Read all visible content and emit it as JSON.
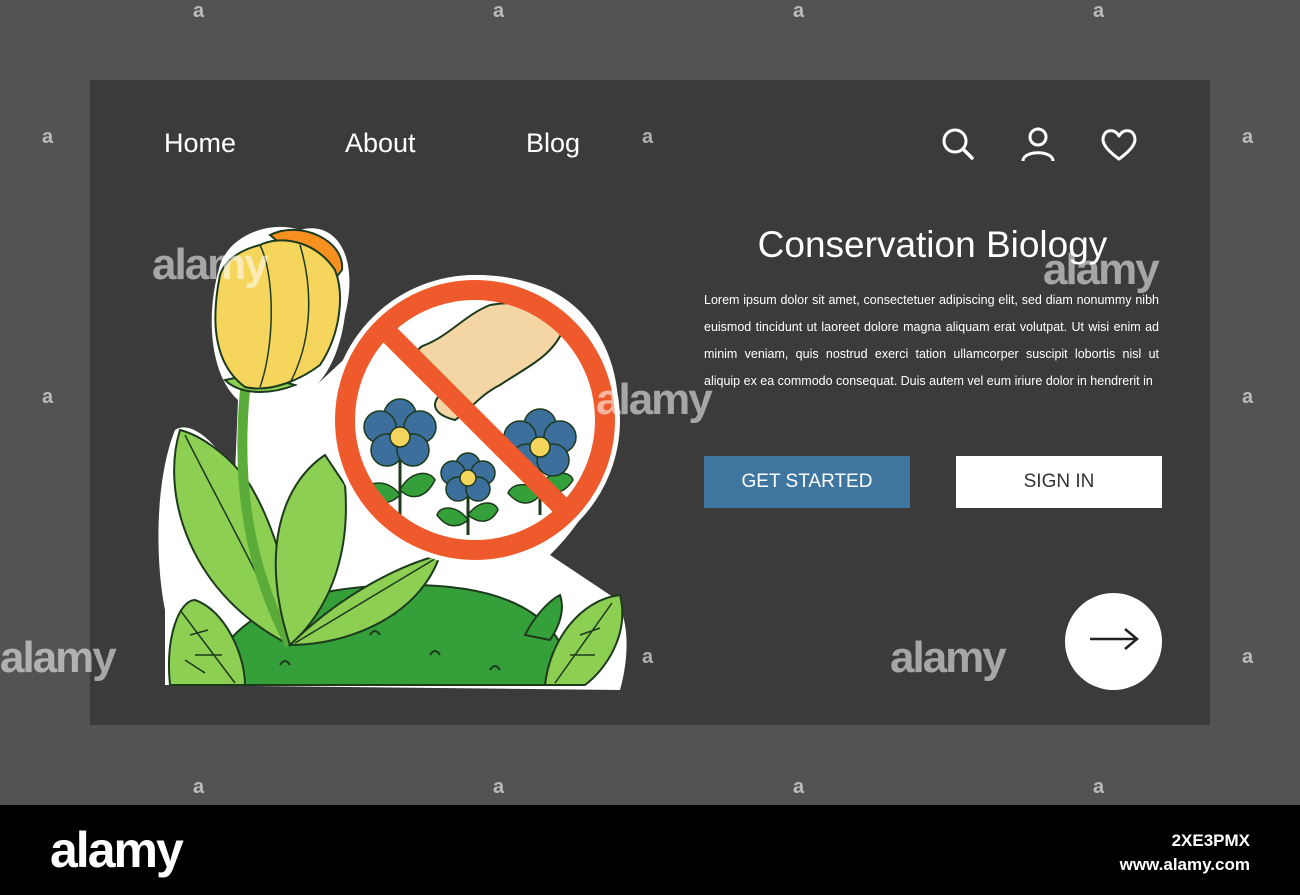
{
  "nav": {
    "items": [
      {
        "label": "Home"
      },
      {
        "label": "About"
      },
      {
        "label": "Blog"
      }
    ],
    "icons": [
      "search-icon",
      "user-icon",
      "heart-icon"
    ]
  },
  "hero": {
    "title": "Conservation Biology",
    "body": "Lorem ipsum dolor sit amet, consectetuer adipiscing elit, sed diam nonummy nibh euismod tincidunt ut laoreet dolore magna aliquam erat volutpat. Ut wisi enim ad minim veniam, quis nostrud exerci tation ullamcorper suscipit lobortis nisl ut aliquip ex ea commodo consequat. Duis autem vel eum iriure dolor in hendrerit in",
    "primary_button": "GET STARTED",
    "secondary_button": "SIGN IN",
    "next_icon": "arrow-right-icon"
  },
  "watermark": {
    "brand": "alamy",
    "mark": "a",
    "image_id": "2XE3PMX",
    "site": "www.alamy.com"
  },
  "colors": {
    "background": "#535353",
    "frame": "#3b3b3b",
    "primary": "#3f76a0",
    "prohibition": "#ef5a2c"
  }
}
